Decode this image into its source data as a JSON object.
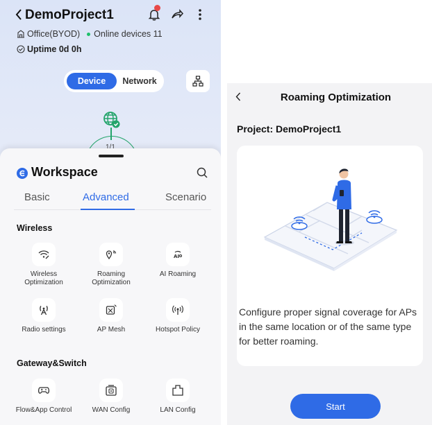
{
  "left": {
    "header": {
      "title": "DemoProject1"
    },
    "site": {
      "name": "Office(BYOD)",
      "online": "Online devices 11"
    },
    "uptime": "Uptime 0d 0h",
    "segment": {
      "device": "Device",
      "network": "Network"
    },
    "topology": {
      "count": "1/1"
    },
    "workspace": {
      "title": "Workspace",
      "tabs": [
        {
          "label": "Basic",
          "active": false
        },
        {
          "label": "Advanced",
          "active": true
        },
        {
          "label": "Scenario",
          "active": false
        }
      ],
      "sections": [
        {
          "title": "Wireless",
          "items": [
            {
              "label": "Wireless Optimization",
              "icon": "wifi-optimize-icon"
            },
            {
              "label": "Roaming Optimization",
              "icon": "roaming-icon"
            },
            {
              "label": "AI Roaming",
              "icon": "ai-roaming-icon"
            },
            {
              "label": "Radio settings",
              "icon": "radio-icon"
            },
            {
              "label": "AP Mesh",
              "icon": "mesh-icon"
            },
            {
              "label": "Hotspot Policy",
              "icon": "hotspot-icon"
            }
          ]
        },
        {
          "title": "Gateway&Switch",
          "items": [
            {
              "label": "Flow&App Control",
              "icon": "gamepad-icon"
            },
            {
              "label": "WAN Config",
              "icon": "wan-icon"
            },
            {
              "label": "LAN Config",
              "icon": "lan-icon"
            }
          ]
        }
      ]
    }
  },
  "right": {
    "title": "Roaming Optimization",
    "project_label": "Project:",
    "project_name": "DemoProject1",
    "description": "Configure proper signal coverage for APs in the same location or of the same type for better roaming.",
    "start_label": "Start"
  },
  "colors": {
    "accent": "#2f6be6",
    "online": "#1ec06a",
    "alert": "#e84848"
  }
}
